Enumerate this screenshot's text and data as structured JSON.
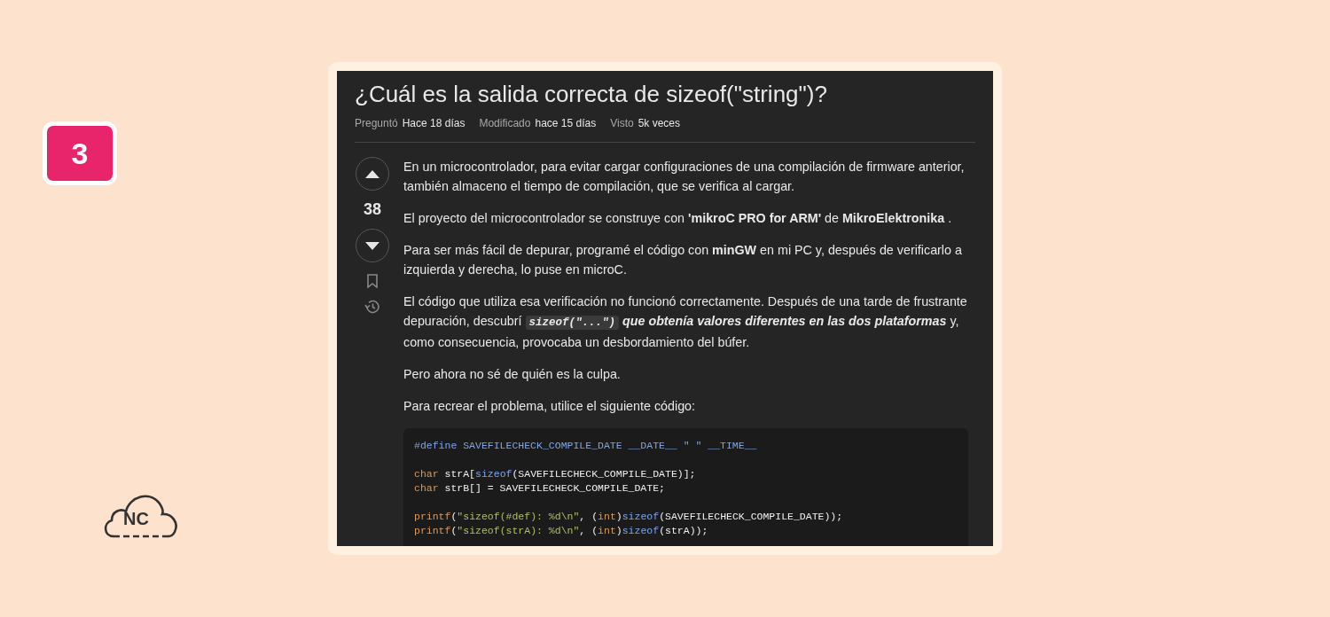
{
  "badge": {
    "text": "3"
  },
  "logo": {
    "text": "NC"
  },
  "question": {
    "title": "¿Cuál es la salida correcta de sizeof(\"string\")?",
    "meta": [
      {
        "label": "Preguntó",
        "value": "Hace 18 días"
      },
      {
        "label": "Modificado",
        "value": "hace 15 días"
      },
      {
        "label": "Visto",
        "value": "5k veces"
      }
    ],
    "score": "38",
    "paragraphs": [
      [
        {
          "kind": "text",
          "text": "En un microcontrolador, para evitar cargar configuraciones de una compilación de firmware anterior, también almaceno el tiempo de compilación, que se verifica al cargar."
        }
      ],
      [
        {
          "kind": "text",
          "text": "El proyecto del microcontrolador se construye con **'mikroC PRO for ARM'** de **MikroElektronika** ."
        }
      ],
      [
        {
          "kind": "text",
          "text": "Para ser más fácil de depurar, programé el código con **minGW** en mi PC y, después de verificarlo a izquierda y derecha, lo puse en microC."
        }
      ],
      [
        {
          "kind": "text",
          "text": "El código que utiliza esa verificación no funcionó correctamente. Después de una tarde de frustrante depuración, descubrí "
        },
        {
          "kind": "code",
          "text": "sizeof(\"...\")"
        },
        {
          "kind": "strong_em",
          "text": " que obtenía valores diferentes en las dos plataformas"
        },
        {
          "kind": "text",
          "text": " y, como consecuencia, provocaba un desbordamiento del búfer."
        }
      ],
      [
        {
          "kind": "text",
          "text": "Pero ahora no sé de quién es la culpa."
        }
      ],
      [
        {
          "kind": "text",
          "text": "Para recrear el problema, utilice el siguiente código:"
        }
      ]
    ],
    "code_lines": [
      {
        "gap_before": false,
        "tokens": [
          {
            "kind": "preproc",
            "text": "#define SAVEFILECHECK_COMPILE_DATE __DATE__ \" \" __TIME__"
          }
        ]
      },
      {
        "gap_before": true,
        "tokens": [
          {
            "kind": "type",
            "text": "char"
          },
          {
            "kind": "plain",
            "text": " strA["
          },
          {
            "kind": "keyword",
            "text": "sizeof"
          },
          {
            "kind": "plain",
            "text": "(SAVEFILECHECK_COMPILE_DATE)];"
          }
        ]
      },
      {
        "gap_before": false,
        "tokens": [
          {
            "kind": "type",
            "text": "char"
          },
          {
            "kind": "plain",
            "text": " strB[] = SAVEFILECHECK_COMPILE_DATE;"
          }
        ]
      },
      {
        "gap_before": true,
        "tokens": [
          {
            "kind": "type",
            "text": "printf"
          },
          {
            "kind": "plain",
            "text": "("
          },
          {
            "kind": "string",
            "text": "\"sizeof(#def): %d\\n\""
          },
          {
            "kind": "plain",
            "text": ", ("
          },
          {
            "kind": "type",
            "text": "int"
          },
          {
            "kind": "plain",
            "text": ")"
          },
          {
            "kind": "keyword",
            "text": "sizeof"
          },
          {
            "kind": "plain",
            "text": "(SAVEFILECHECK_COMPILE_DATE));"
          }
        ]
      },
      {
        "gap_before": false,
        "tokens": [
          {
            "kind": "type",
            "text": "printf"
          },
          {
            "kind": "plain",
            "text": "("
          },
          {
            "kind": "string",
            "text": "\"sizeof(strA): %d\\n\""
          },
          {
            "kind": "plain",
            "text": ", ("
          },
          {
            "kind": "type",
            "text": "int"
          },
          {
            "kind": "plain",
            "text": ")"
          },
          {
            "kind": "keyword",
            "text": "sizeof"
          },
          {
            "kind": "plain",
            "text": "(strA));"
          }
        ]
      }
    ]
  }
}
